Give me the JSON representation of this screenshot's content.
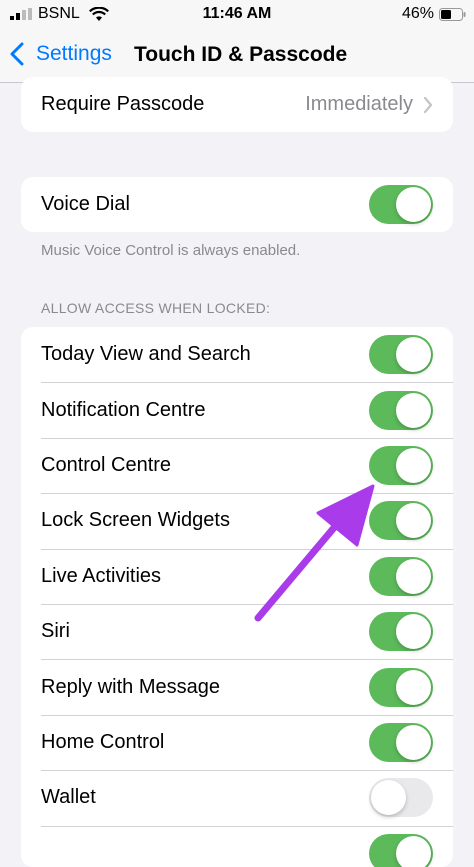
{
  "status_bar": {
    "carrier": "BSNL",
    "time": "11:46 AM",
    "battery": "46%"
  },
  "nav": {
    "back_label": "Settings",
    "title": "Touch ID & Passcode"
  },
  "require_passcode": {
    "label": "Require Passcode",
    "value": "Immediately"
  },
  "voice_dial": {
    "label": "Voice Dial",
    "on": true,
    "footnote": "Music Voice Control is always enabled."
  },
  "access_section": {
    "header": "ALLOW ACCESS WHEN LOCKED:",
    "items": [
      {
        "label": "Today View and Search",
        "on": true
      },
      {
        "label": "Notification Centre",
        "on": true
      },
      {
        "label": "Control Centre",
        "on": true
      },
      {
        "label": "Lock Screen Widgets",
        "on": true
      },
      {
        "label": "Live Activities",
        "on": true
      },
      {
        "label": "Siri",
        "on": true
      },
      {
        "label": "Reply with Message",
        "on": true
      },
      {
        "label": "Home Control",
        "on": true
      },
      {
        "label": "Wallet",
        "on": false
      }
    ]
  },
  "colors": {
    "toggle_on": "#5cba5a",
    "toggle_off": "#e9e9eb",
    "accent": "#007aff",
    "annotation_arrow": "#a93bea"
  }
}
